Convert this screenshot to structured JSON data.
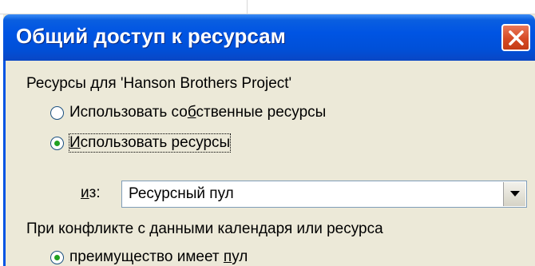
{
  "dialog": {
    "title": "Общий доступ к ресурсам",
    "close_icon": "close-icon",
    "accent_color": "#0054e3"
  },
  "resources_group": {
    "label": "Ресурсы для 'Hanson Brothers Project'",
    "option_own": {
      "pre": "Использовать со",
      "accel": "б",
      "post": "ственные ресурсы",
      "checked": false
    },
    "option_pool": {
      "pre": "",
      "accel": "И",
      "post": "спользовать ресурсы",
      "checked": true
    },
    "from_label_accel": "и",
    "from_label_rest": "з:",
    "pool_select_value": "Ресурсный пул",
    "dropdown_icon": "chevron-down-icon"
  },
  "conflict_group": {
    "label": "При конфликте с данными календаря или ресурса",
    "option_pool_wins": {
      "pre": "преимущество имеет ",
      "accel": "п",
      "post": "ул",
      "checked": true
    }
  }
}
